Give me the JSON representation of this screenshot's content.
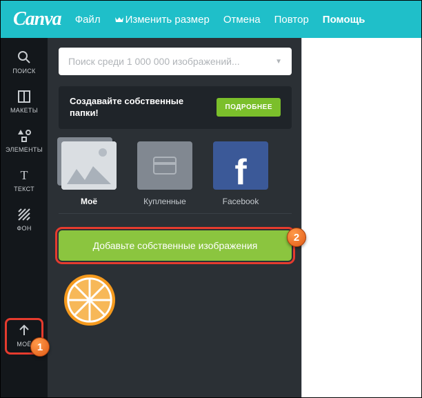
{
  "logo": "Canva",
  "topbar": {
    "file": "Файл",
    "resize": "Изменить размер",
    "undo": "Отмена",
    "redo": "Повтор",
    "help": "Помощь"
  },
  "rail": {
    "search": "ПОИСК",
    "layouts": "МАКЕТЫ",
    "elements": "ЭЛЕМЕНТЫ",
    "text": "ТЕКСТ",
    "background": "ФОН",
    "uploads": "МОЁ"
  },
  "search": {
    "placeholder": "Поиск среди 1 000 000 изображений..."
  },
  "promo": {
    "text": "Создавайте собственные папки!",
    "button": "ПОДРОБНЕЕ"
  },
  "tabs": {
    "my": "Моё",
    "bought": "Купленные",
    "facebook": "Facebook"
  },
  "upload": {
    "button": "Добавьте собственные изображения"
  },
  "badges": {
    "one": "1",
    "two": "2"
  }
}
